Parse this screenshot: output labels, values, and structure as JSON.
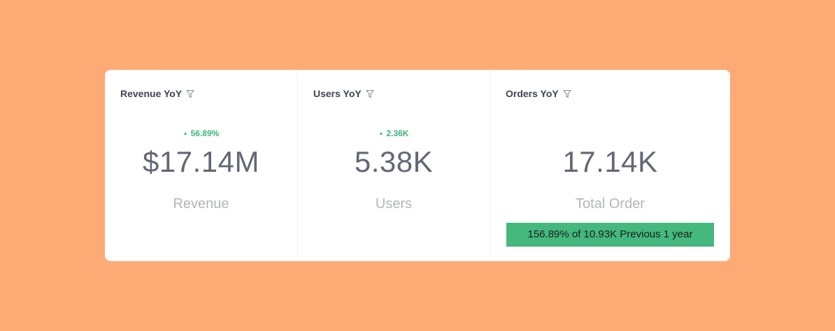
{
  "widgets": [
    {
      "title": "Revenue YoY",
      "delta": "56.89%",
      "value": "$17.14M",
      "label": "Revenue"
    },
    {
      "title": "Users YoY",
      "delta": "2.36K",
      "value": "5.38K",
      "label": "Users"
    },
    {
      "title": "Orders YoY",
      "value": "17.14K",
      "label": "Total Order",
      "comparison": "156.89% of 10.93K Previous 1 year",
      "comparison_fraction": 1.0
    }
  ],
  "icons": {
    "filter": "filter-icon",
    "delta_up": "caret-up-icon"
  },
  "colors": {
    "background": "#FEAA75",
    "card": "#FFFFFF",
    "positive": "#3DB47A",
    "comparison_bar": "#45B87E"
  }
}
